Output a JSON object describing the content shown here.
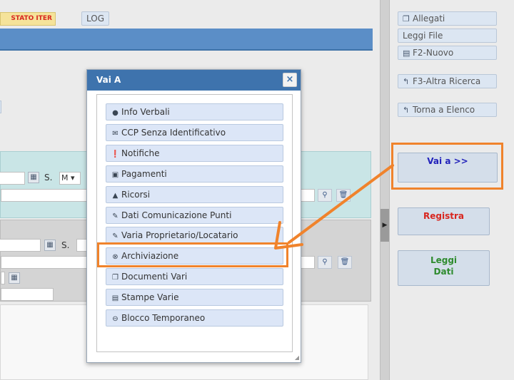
{
  "tabs": {
    "stato_iter": "STATO ITER",
    "log": "LOG"
  },
  "form": {
    "s_label_1": "S.",
    "s_select_1": "M",
    "s_label_2": "S."
  },
  "sidebar": {
    "allegati": "Allegati",
    "leggi_file": "Leggi File",
    "f2_nuovo": "F2-Nuovo",
    "f3_altra_ricerca": "F3-Altra Ricerca",
    "torna_elenco": "Torna a Elenco",
    "vai_a": "Vai a >>",
    "registra": "Registra",
    "leggi_dati_line1": "Leggi",
    "leggi_dati_line2": "Dati"
  },
  "modal": {
    "title": "Vai A",
    "close": "×",
    "items": [
      {
        "label": "Info Verbali",
        "icon": "info-icon"
      },
      {
        "label": "CCP Senza Identificativo",
        "icon": "envelope-icon"
      },
      {
        "label": "Notifiche",
        "icon": "exclamation-icon"
      },
      {
        "label": "Pagamenti",
        "icon": "inbox-icon"
      },
      {
        "label": "Ricorsi",
        "icon": "warning-icon"
      },
      {
        "label": "Dati Comunicazione Punti",
        "icon": "pencil-icon"
      },
      {
        "label": "Varia Proprietario/Locatario",
        "icon": "pencil-icon"
      },
      {
        "label": "Archiviazione",
        "icon": "remove-circle-icon"
      },
      {
        "label": "Documenti Vari",
        "icon": "copy-icon"
      },
      {
        "label": "Stampe Varie",
        "icon": "print-icon"
      },
      {
        "label": "Blocco Temporaneo",
        "icon": "minus-circle-icon"
      }
    ]
  },
  "colors": {
    "header_blue": "#3e73ad",
    "highlight_orange": "#f0832c",
    "registra_red": "#d8261f",
    "leggi_dati_green": "#2e8b2e",
    "vai_a_blue": "#2222bb"
  }
}
